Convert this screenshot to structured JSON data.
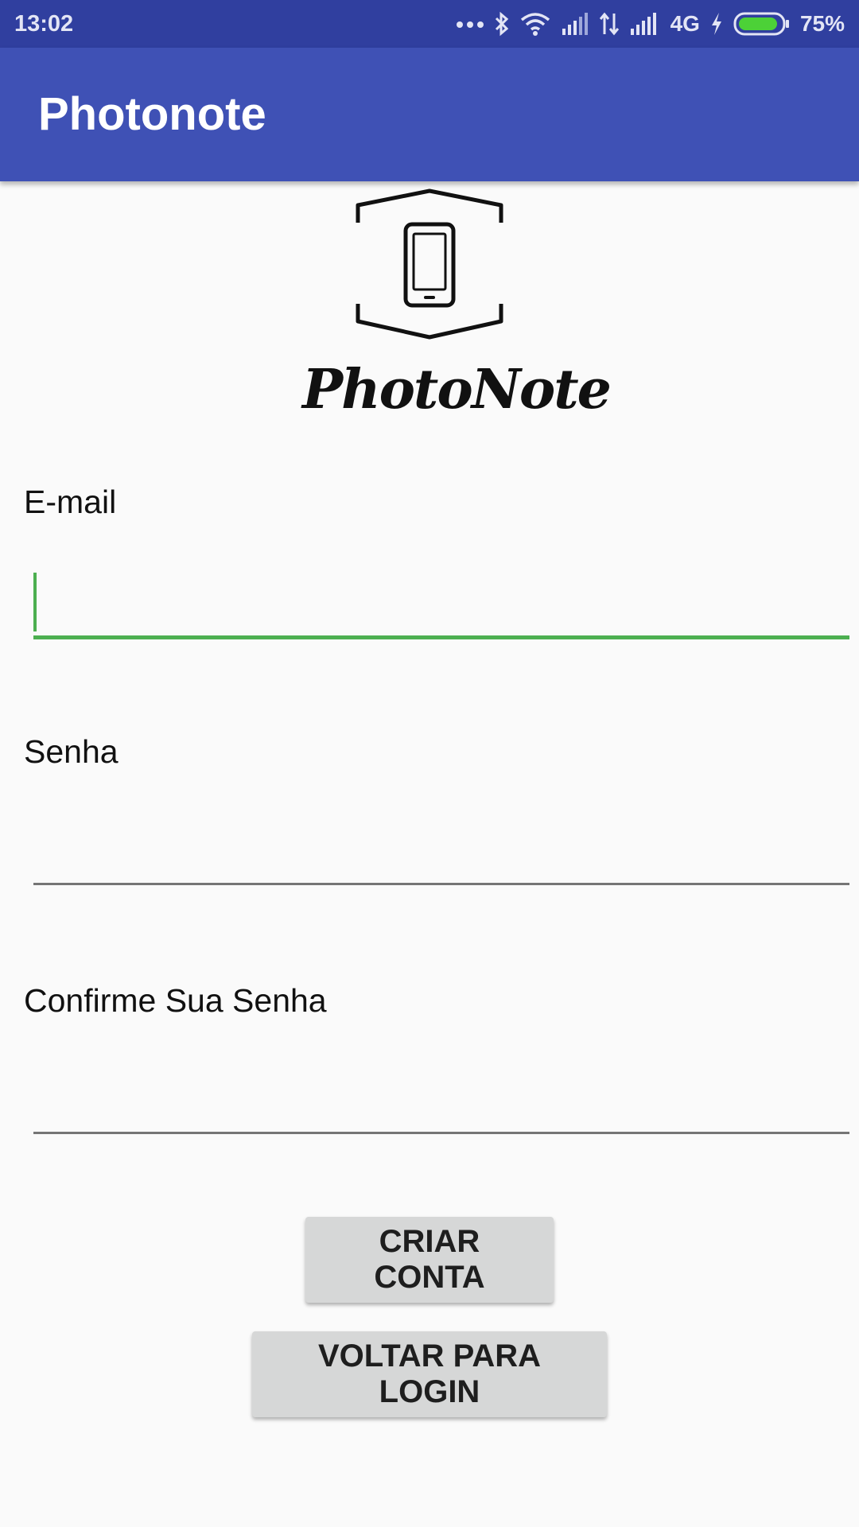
{
  "status_bar": {
    "time": "13:02",
    "network": "4G",
    "battery": "75%",
    "icons": [
      "more-dots-icon",
      "bluetooth-icon",
      "wifi-icon",
      "signal-icon",
      "data-arrows-icon",
      "signal-icon",
      "charging-icon",
      "battery-icon"
    ]
  },
  "app_bar": {
    "title": "Photonote"
  },
  "logo": {
    "icon": "phone-camera-logo-icon",
    "wordmark": "PhotoNote"
  },
  "form": {
    "email": {
      "label": "E-mail",
      "value": ""
    },
    "password": {
      "label": "Senha",
      "value": ""
    },
    "confirm_password": {
      "label": "Confirme Sua Senha",
      "value": ""
    }
  },
  "buttons": {
    "create_account": "CRIAR CONTA",
    "back_to_login": "VOLTAR PARA LOGIN"
  },
  "colors": {
    "status_bar": "#303F9F",
    "app_bar": "#3F51B5",
    "focus_accent": "#4CAF50",
    "background": "#FAFAFA",
    "button": "#D6D7D7"
  }
}
